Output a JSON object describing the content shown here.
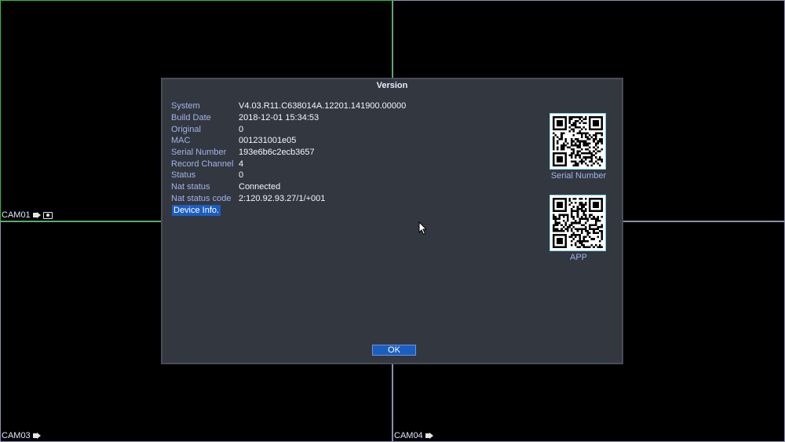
{
  "cameras": [
    {
      "label": "CAM01"
    },
    {
      "label": "CAM03"
    },
    {
      "label": "CAM04"
    }
  ],
  "dialog": {
    "title": "Version",
    "rows": [
      {
        "key": "System",
        "value": "V4.03.R11.C638014A.12201.141900.00000"
      },
      {
        "key": "Build Date",
        "value": "2018-12-01 15:34:53"
      },
      {
        "key": "Original",
        "value": "0"
      },
      {
        "key": "MAC",
        "value": "001231001e05"
      },
      {
        "key": "Serial Number",
        "value": "193e6b6c2ecb3657"
      },
      {
        "key": "Record Channel",
        "value": "4"
      },
      {
        "key": "Status",
        "value": "0"
      },
      {
        "key": "Nat status",
        "value": "Connected"
      },
      {
        "key": "Nat status code",
        "value": "2:120.92.93.27/1/+001"
      }
    ],
    "device_info_label": "Device Info.",
    "qr_serial_label": "Serial Number",
    "qr_app_label": "APP",
    "ok_label": "OK"
  },
  "colors": {
    "accent": "#1b5ec2",
    "dialog_bg": "#333740",
    "label_text": "#9fb4ea",
    "cam1_border": "#2fbf3a"
  }
}
